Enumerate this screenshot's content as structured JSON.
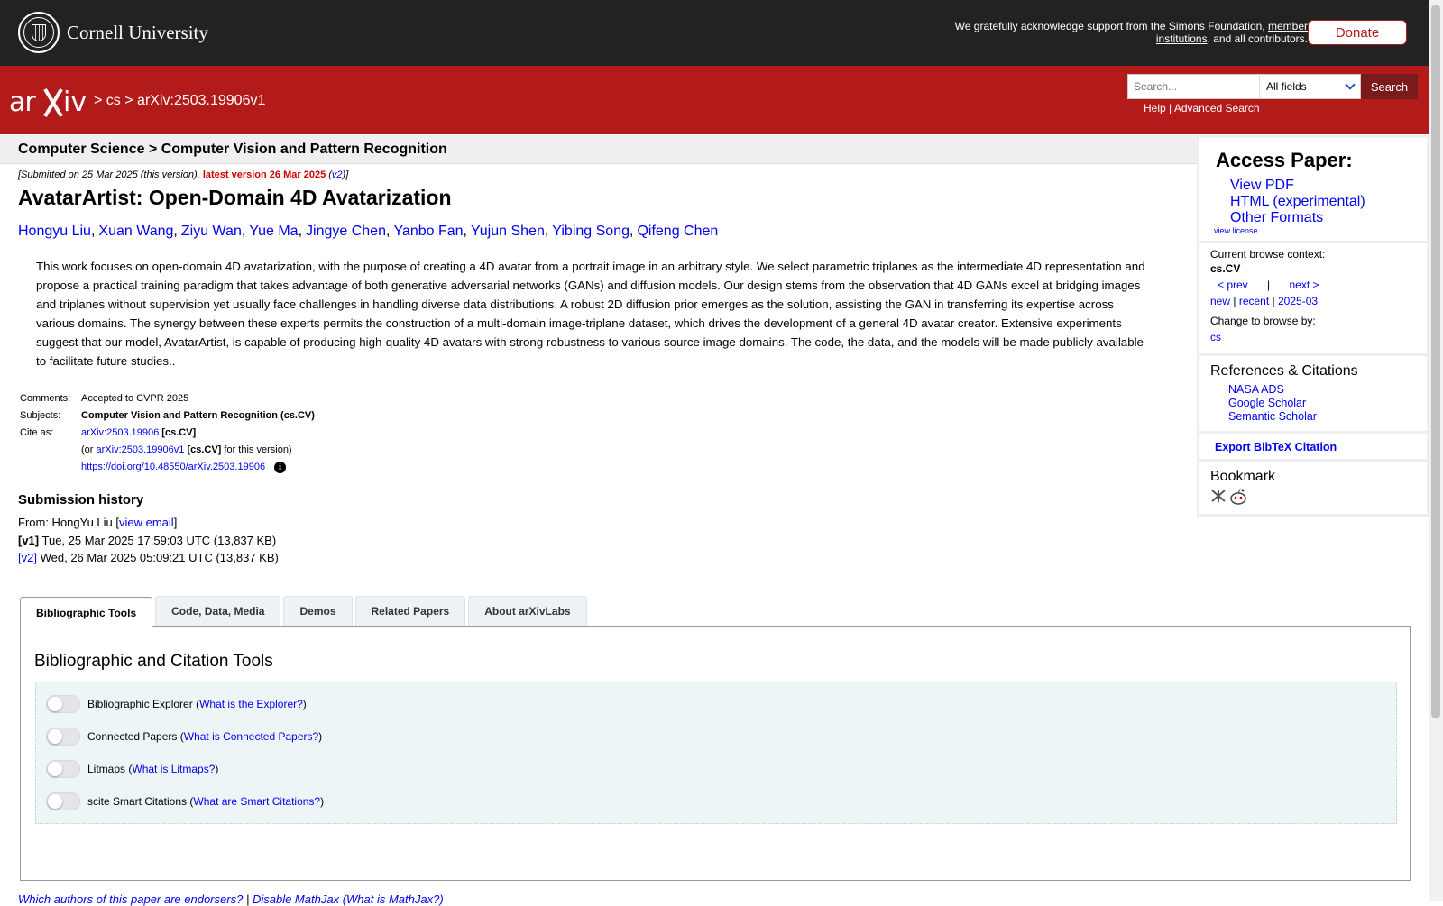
{
  "header": {
    "university": "Cornell University",
    "support_prefix": "We gratefully acknowledge support from the Simons Foundation,",
    "support_link": "member institutions",
    "support_suffix": ", and all contributors.",
    "donate": "Donate"
  },
  "arxiv_bar": {
    "breadcrumb": [
      ">",
      "cs",
      ">",
      "arXiv:2503.19906v1"
    ],
    "search_placeholder": "Search...",
    "search_field": "All fields",
    "search_button": "Search",
    "help": "Help",
    "separator": "|",
    "advanced": "Advanced Search"
  },
  "subject_header": "Computer Science > Computer Vision and Pattern Recognition",
  "dateline": {
    "prefix": "[Submitted on 25 Mar 2025 (this version),",
    "latest": "latest version 26 Mar 2025",
    "open": "(",
    "v2": "v2",
    "close": ")]"
  },
  "title": "AvatarArtist: Open-Domain 4D Avatarization",
  "authors": [
    "Hongyu Liu",
    "Xuan Wang",
    "Ziyu Wan",
    "Yue Ma",
    "Jingye Chen",
    "Yanbo Fan",
    "Yujun Shen",
    "Yibing Song",
    "Qifeng Chen"
  ],
  "author_sep": ",",
  "abstract": "This work focuses on open-domain 4D avatarization, with the purpose of creating a 4D avatar from a portrait image in an arbitrary style. We select parametric triplanes as the intermediate 4D representation and propose a practical training paradigm that takes advantage of both generative adversarial networks (GANs) and diffusion models. Our design stems from the observation that 4D GANs excel at bridging images and triplanes without supervision yet usually face challenges in handling diverse data distributions. A robust 2D diffusion prior emerges as the solution, assisting the GAN in transferring its expertise across various domains. The synergy between these experts permits the construction of a multi-domain image-triplane dataset, which drives the development of a general 4D avatar creator. Extensive experiments suggest that our model, AvatarArtist, is capable of producing high-quality 4D avatars with strong robustness to various source image domains. The code, the data, and the models will be made publicly available to facilitate future studies..",
  "meta": {
    "comments_label": "Comments:",
    "comments": "Accepted to CVPR 2025",
    "subjects_label": "Subjects:",
    "subjects": "Computer Vision and Pattern Recognition (cs.CV)",
    "cite_label": "Cite as:",
    "cite_id": "arXiv:2503.19906",
    "cite_cat": "[cs.CV]",
    "or_prefix": "(or",
    "cite_version": "arXiv:2503.19906v1",
    "or_suffix": "for this version)",
    "doi": "https://doi.org/10.48550/arXiv.2503.19906",
    "info_glyph": "i"
  },
  "history": {
    "title": "Submission history",
    "from": "From: HongYu Liu [",
    "view_email": "view email",
    "from_close": "]",
    "v1_label": "[v1]",
    "v1_text": "Tue, 25 Mar 2025 17:59:03 UTC (13,837 KB)",
    "v2_label": "[v2]",
    "v2_text": "Wed, 26 Mar 2025 05:09:21 UTC (13,837 KB)"
  },
  "sidebar": {
    "access_title": "Access Paper:",
    "access_links": [
      "View PDF",
      "HTML (experimental)",
      "Other Formats"
    ],
    "view_license": "view license",
    "context_label": "Current browse context:",
    "context": "cs.CV",
    "prev": "< prev",
    "nav_sep": "|",
    "next": "next >",
    "new": "new",
    "recent": "recent",
    "month": "2025-03",
    "change_label": "Change to browse by:",
    "cs": "cs",
    "refs_title": "References & Citations",
    "refs": [
      "NASA ADS",
      "Google Scholar",
      "Semantic Scholar"
    ],
    "export": "Export BibTeX Citation",
    "bookmark": "Bookmark"
  },
  "tabs": [
    "Bibliographic Tools",
    "Code, Data, Media",
    "Demos",
    "Related Papers",
    "About arXivLabs"
  ],
  "panel": {
    "title": "Bibliographic and Citation Tools",
    "tools": [
      {
        "name": "Bibliographic Explorer",
        "help": "What is the Explorer?"
      },
      {
        "name": "Connected Papers",
        "help": "What is Connected Papers?"
      },
      {
        "name": "Litmaps",
        "help": "What is Litmaps?"
      },
      {
        "name": "scite Smart Citations",
        "help": "What are Smart Citations?"
      }
    ]
  },
  "footer": {
    "endorsers": "Which authors of this paper are endorsers?",
    "sep": "|",
    "mathjax": "Disable MathJax",
    "what_mathjax": "(What is MathJax?)"
  },
  "colors": {
    "arxiv_red": "#b31b1b",
    "cornell_dark": "#222222",
    "link_blue": "#0000ee"
  }
}
